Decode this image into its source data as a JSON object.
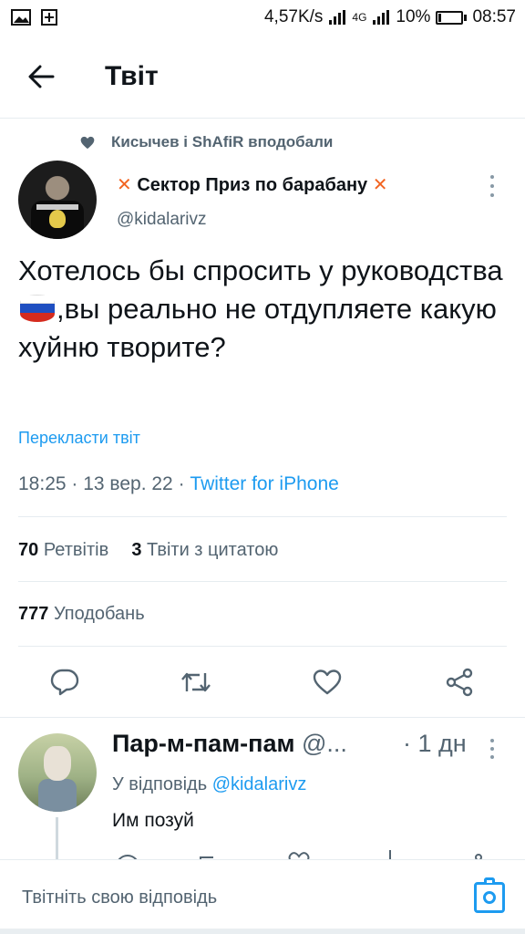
{
  "status_bar": {
    "speed": "4,57K/s",
    "network": "4G",
    "battery": "10%",
    "time": "08:57"
  },
  "header": {
    "title": "Твіт"
  },
  "liked_by": "Кисычев і ShAfiR вподобали",
  "tweet": {
    "author_name_mark_left": "✕",
    "author_name": "Сектор Приз по барабану",
    "author_name_mark_right": "✕",
    "author_handle": "@kidalarivz",
    "text_part1": "Хотелось бы спросить у руководства ",
    "text_part2": ",вы реально не отдупляете какую хуйню творите?",
    "translate_label": "Перекласти твіт",
    "time": "18:25",
    "date": "13 вер. 22",
    "source": "Twitter for iPhone",
    "retweets_count": "70",
    "retweets_label": "Ретвітів",
    "quotes_count": "3",
    "quotes_label": "Твіти з цитатою",
    "likes_count": "777",
    "likes_label": "Уподобань"
  },
  "reply": {
    "author_name": "Пар-м-пам-пам",
    "author_handle_trunc": "@...",
    "time_ago": "· 1 дн",
    "reply_to_label": "У відповідь",
    "reply_to_handle": "@kidalarivz",
    "text": "Им позуй"
  },
  "composer": {
    "placeholder": "Твітніть свою відповідь"
  },
  "colors": {
    "accent": "#1d9bf0",
    "secondary_text": "#536471",
    "name_mark": "#f26522"
  },
  "icons": [
    "back-arrow-icon",
    "heart-icon",
    "reply-icon",
    "retweet-icon",
    "like-icon",
    "share-icon",
    "more-icon",
    "camera-icon",
    "flag-emoji-icon"
  ]
}
